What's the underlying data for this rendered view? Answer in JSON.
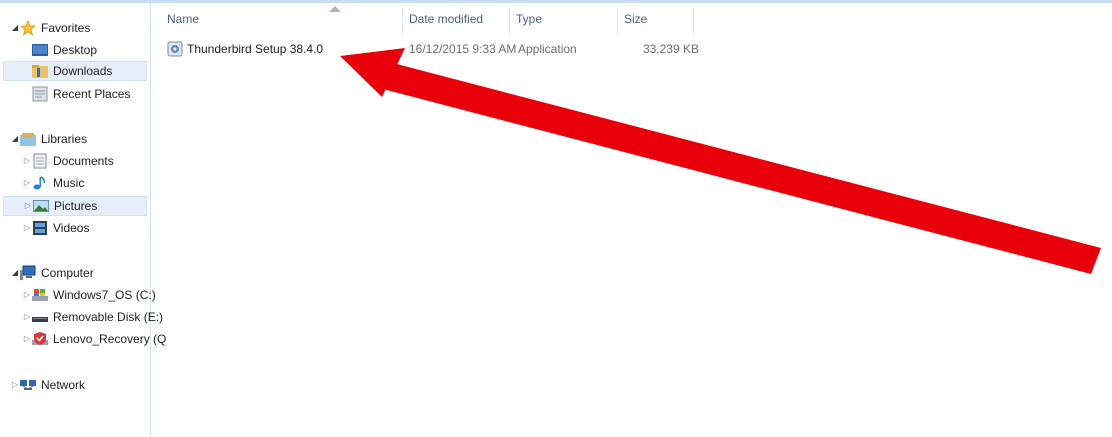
{
  "nav": {
    "favorites": {
      "label": "Favorites",
      "items": [
        {
          "label": "Desktop",
          "icon": "desktop-icon"
        },
        {
          "label": "Downloads",
          "icon": "downloads-folder-icon",
          "selected": true
        },
        {
          "label": "Recent Places",
          "icon": "recent-places-icon"
        }
      ]
    },
    "libraries": {
      "label": "Libraries",
      "items": [
        {
          "label": "Documents",
          "icon": "documents-icon"
        },
        {
          "label": "Music",
          "icon": "music-icon"
        },
        {
          "label": "Pictures",
          "icon": "pictures-icon",
          "hovered": true
        },
        {
          "label": "Videos",
          "icon": "videos-icon"
        }
      ]
    },
    "computer": {
      "label": "Computer",
      "items": [
        {
          "label": "Windows7_OS (C:)",
          "icon": "drive-c-icon"
        },
        {
          "label": "Removable Disk (E:)",
          "icon": "removable-disk-icon"
        },
        {
          "label": "Lenovo_Recovery (Q",
          "icon": "recovery-drive-icon"
        }
      ]
    },
    "network": {
      "label": "Network",
      "icon": "network-icon"
    }
  },
  "columns": {
    "name": "Name",
    "date": "Date modified",
    "type": "Type",
    "size": "Size"
  },
  "files": [
    {
      "name": "Thunderbird Setup 38.4.0",
      "date": "16/12/2015 9:33 AM",
      "type": "Application",
      "size": "33,239 KB",
      "icon": "installer-icon"
    }
  ],
  "annotation": {
    "color": "#e8000b"
  }
}
